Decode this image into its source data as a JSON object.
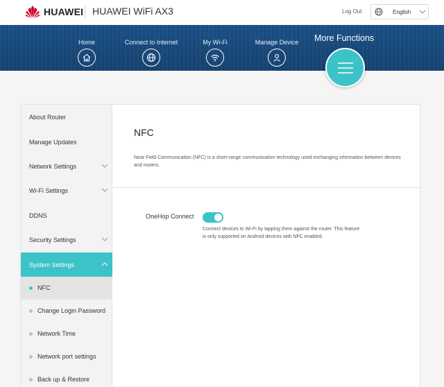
{
  "header": {
    "brand": "HUAWEI",
    "product": "HUAWEI WiFi AX3",
    "logout_label": "Log Out",
    "language": "English"
  },
  "nav": {
    "items": [
      {
        "label": "Home",
        "icon": "home-icon"
      },
      {
        "label": "Connect to Internet",
        "icon": "globe-icon"
      },
      {
        "label": "My Wi-Fi",
        "icon": "wifi-icon"
      },
      {
        "label": "Manage Device",
        "icon": "user-icon"
      }
    ],
    "more": {
      "label": "More Functions",
      "icon": "menu-icon"
    }
  },
  "sidebar": {
    "items": [
      {
        "label": "About Router"
      },
      {
        "label": "Manage Updates"
      },
      {
        "label": "Network Settings"
      },
      {
        "label": "Wi-Fi Settings"
      },
      {
        "label": "DDNS"
      },
      {
        "label": "Security Settings"
      },
      {
        "label": "System Settings"
      }
    ],
    "subitems": [
      {
        "label": "NFC"
      },
      {
        "label": "Change Login Password"
      },
      {
        "label": "Network Time"
      },
      {
        "label": "Network port settings"
      },
      {
        "label": "Back up & Restore"
      }
    ]
  },
  "main": {
    "title": "NFC",
    "description": "Near Field Communication (NFC) is a short-range communication technology used exchanging information between devices and routers.",
    "setting": {
      "label": "OneHop Connect",
      "enabled": true,
      "help": "Connect devices to Wi-Fi by tapping them against the router. This feature is only supported on Android devices with NFC enabled."
    }
  },
  "colors": {
    "accent": "#3cc3c7",
    "nav_band": "#1b4f86",
    "brand_red": "#cf0a2c"
  }
}
